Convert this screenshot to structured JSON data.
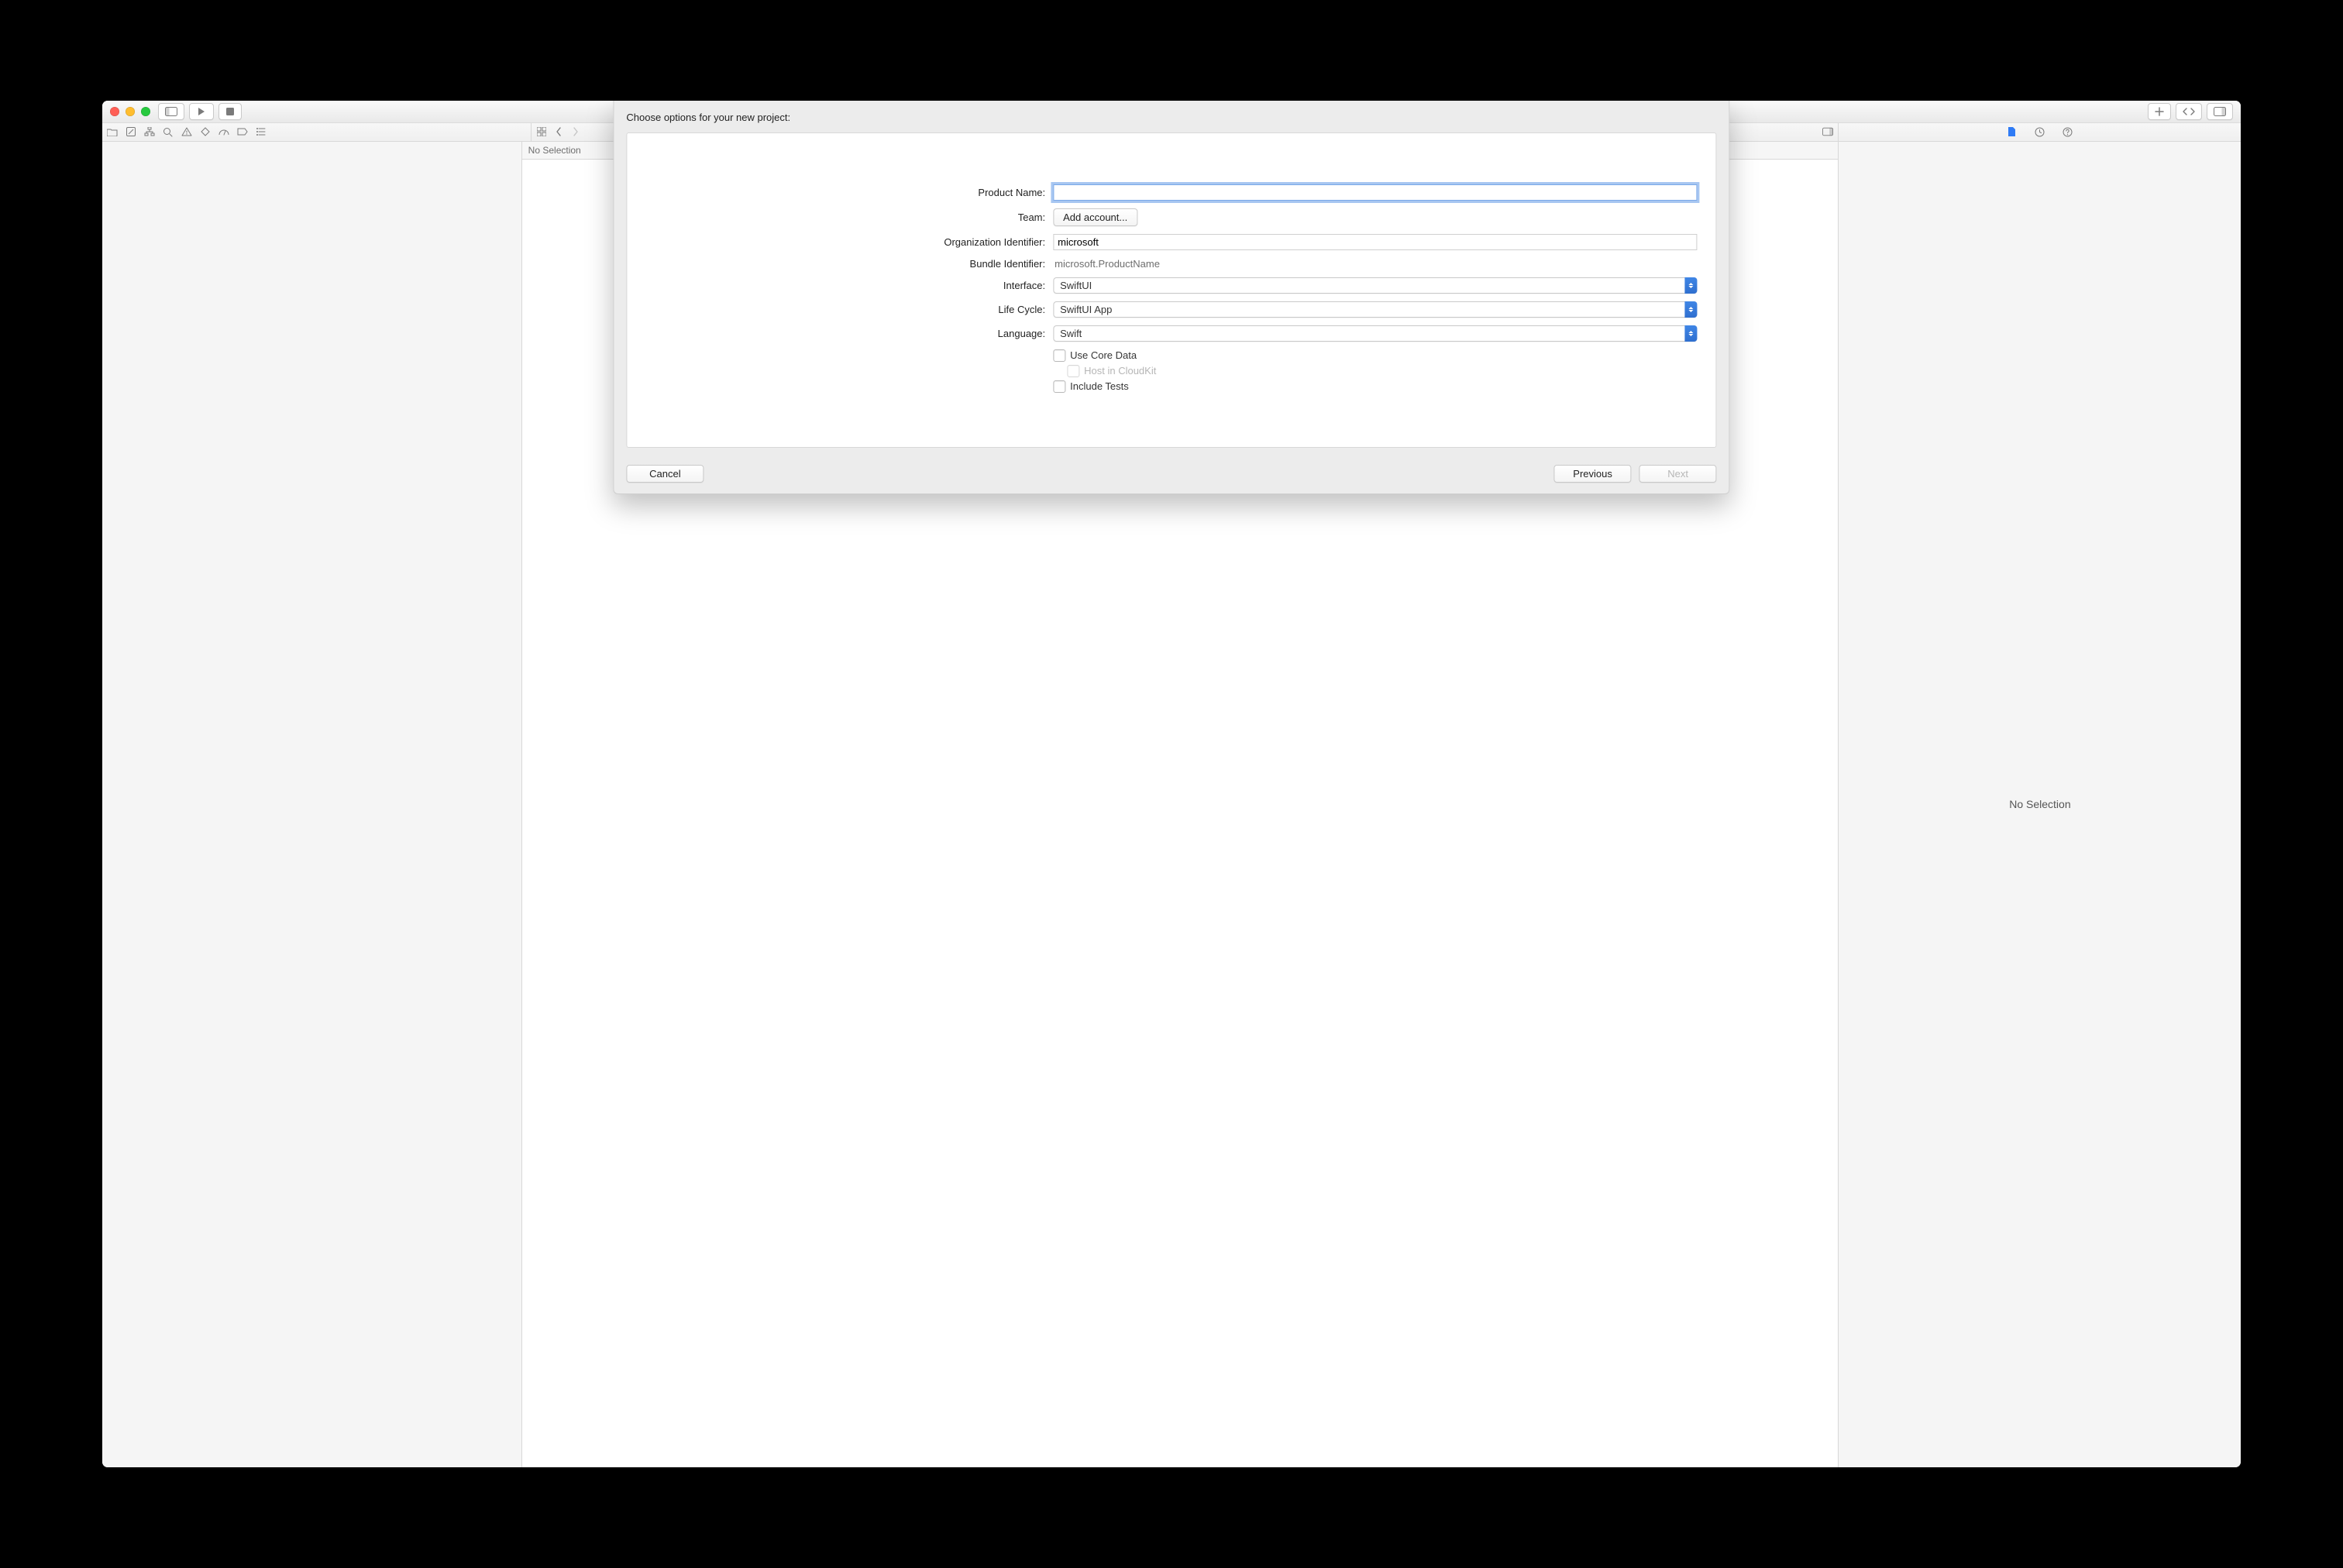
{
  "center": {
    "no_selection_label": "No Selection"
  },
  "inspector": {
    "no_selection_label": "No Selection"
  },
  "sheet": {
    "title": "Choose options for your new project:",
    "labels": {
      "product_name": "Product Name:",
      "team": "Team:",
      "org_identifier": "Organization Identifier:",
      "bundle_identifier": "Bundle Identifier:",
      "interface": "Interface:",
      "life_cycle": "Life Cycle:",
      "language": "Language:"
    },
    "values": {
      "product_name": "",
      "team_button": "Add account...",
      "org_identifier": "microsoft",
      "bundle_identifier": "microsoft.ProductName",
      "interface": "SwiftUI",
      "life_cycle": "SwiftUI App",
      "language": "Swift"
    },
    "checkboxes": {
      "use_core_data": "Use Core Data",
      "host_cloudkit": "Host in CloudKit",
      "include_tests": "Include Tests"
    },
    "buttons": {
      "cancel": "Cancel",
      "previous": "Previous",
      "next": "Next"
    }
  }
}
